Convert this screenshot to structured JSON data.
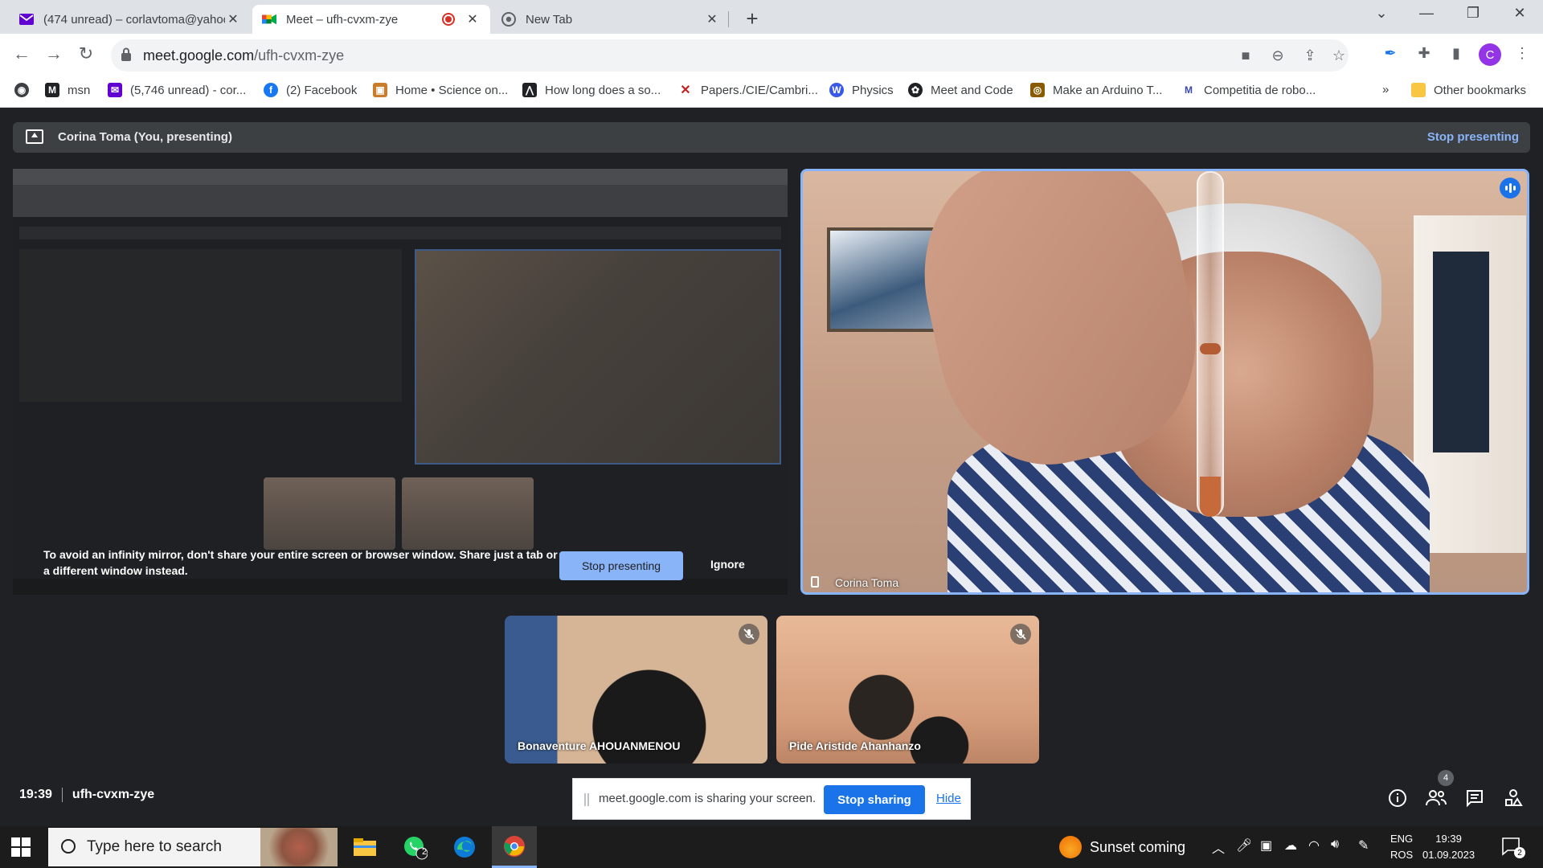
{
  "browser": {
    "tabs": [
      {
        "title": "(474 unread) – corlavtoma@yahoo",
        "icon": "yahoo-mail-icon"
      },
      {
        "title": "Meet – ufh-cvxm-zye",
        "icon": "google-meet-icon"
      },
      {
        "title": "New Tab",
        "icon": "chrome-icon"
      }
    ],
    "url_host": "meet.google.com",
    "url_path": "/ufh-cvxm-zye",
    "profile_initial": "C",
    "bookmarks": [
      {
        "label": "msn",
        "icon": "msn-icon"
      },
      {
        "label": "(5,746 unread) - cor...",
        "icon": "yahoo-mail-icon"
      },
      {
        "label": "(2) Facebook",
        "icon": "facebook-icon"
      },
      {
        "label": "Home • Science on...",
        "icon": "science-icon"
      },
      {
        "label": "How long does a so...",
        "icon": "bookmark-icon"
      },
      {
        "label": "Papers./CIE/Cambri...",
        "icon": "papers-icon"
      },
      {
        "label": "Physics",
        "icon": "wordpress-icon"
      },
      {
        "label": "Meet and Code",
        "icon": "meet-and-code-icon"
      },
      {
        "label": "Make an Arduino T...",
        "icon": "arduino-icon"
      },
      {
        "label": "Competitia de robo...",
        "icon": "robotics-icon"
      }
    ],
    "more_bookmarks": "»",
    "other_bookmarks": "Other bookmarks"
  },
  "meet": {
    "presenting_banner": "Corina Toma (You, presenting)",
    "stop_presenting": "Stop presenting",
    "mirror_warning": "To avoid an infinity mirror, don't share your entire screen or browser window. Share just a tab or a different window instead.",
    "mirror_stop": "Stop presenting",
    "mirror_ignore": "Ignore",
    "main_participant": "Corina Toma",
    "participants": [
      {
        "name": "Bonaventure AHOUANMENOU",
        "muted": true
      },
      {
        "name": "Pide Aristide Ahanhanzo",
        "muted": true
      }
    ],
    "time": "19:39",
    "meeting_code": "ufh-cvxm-zye",
    "people_count": "4",
    "share_message": "meet.google.com is sharing your screen.",
    "stop_sharing": "Stop sharing",
    "hide": "Hide"
  },
  "taskbar": {
    "search_placeholder": "Type here to search",
    "weather": "Sunset coming",
    "lang_top": "ENG",
    "lang_bottom": "ROS",
    "clock_time": "19:39",
    "clock_date": "01.09.2023",
    "notifications": "2",
    "whatsapp_badge": "2"
  },
  "colors": {
    "meet_bg": "#202124",
    "accent_blue": "#8ab4f8",
    "button_blue": "#1a73e8"
  }
}
